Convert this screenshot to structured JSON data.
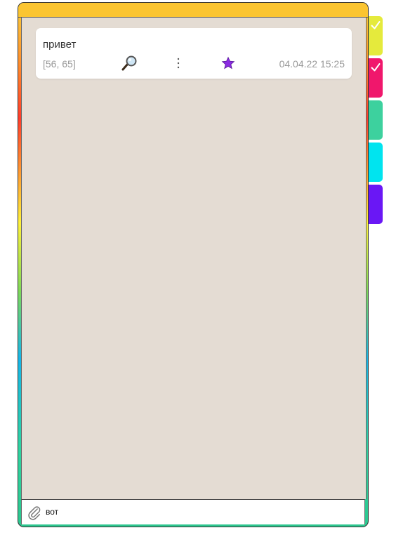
{
  "card": {
    "title": "привет",
    "coords": "[56, 65]",
    "timestamp": "04.04.22 15:25",
    "icons": [
      "search-icon",
      "more-vertical-icon",
      "star-icon"
    ],
    "star_color": "#8b2be2"
  },
  "composer": {
    "value": "вот",
    "icon": "paperclip-icon"
  },
  "tabs": [
    {
      "color": "#e5ea3c",
      "checked": true
    },
    {
      "color": "#f0176c",
      "checked": true
    },
    {
      "color": "#3dd19e",
      "checked": false
    },
    {
      "color": "#00e4ef",
      "checked": false
    },
    {
      "color": "#6a17f5",
      "checked": false
    }
  ],
  "colors": {
    "board_bg": "#e4dcd3",
    "topbar": "#fbc531"
  }
}
